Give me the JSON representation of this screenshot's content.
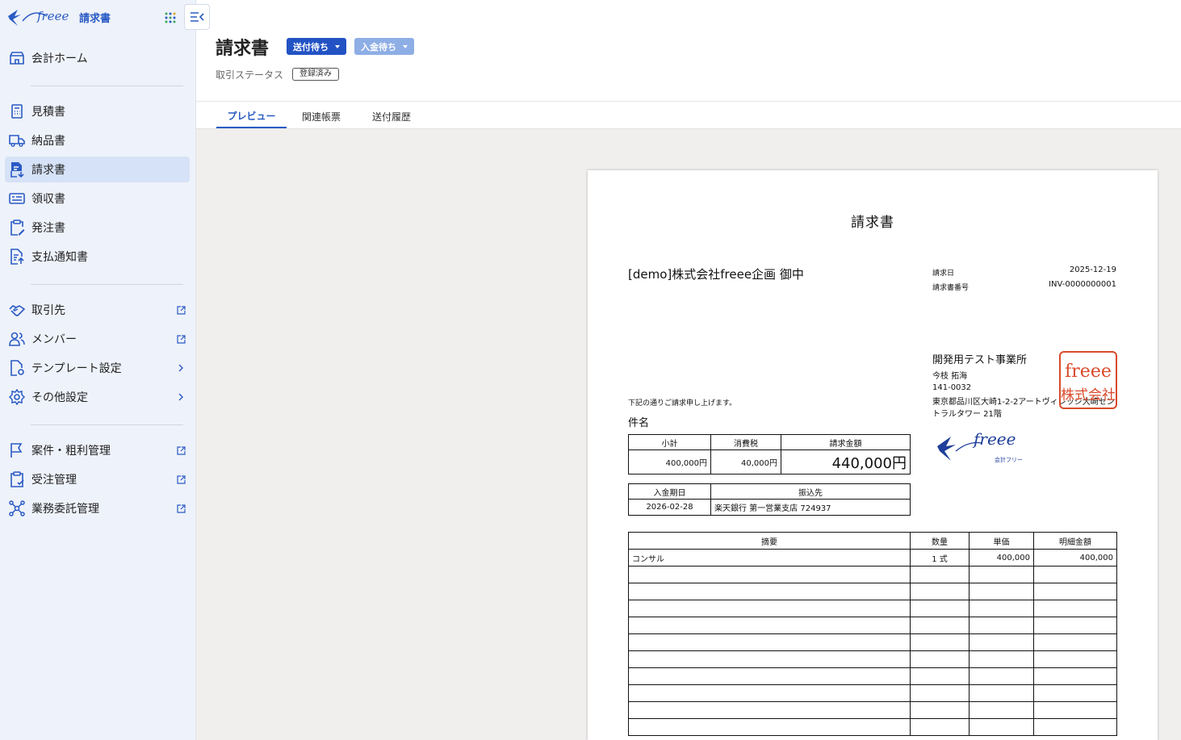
{
  "brand": {
    "product": "請求書"
  },
  "sidebar": {
    "items": [
      {
        "label": "会計ホーム"
      },
      {
        "label": "見積書"
      },
      {
        "label": "納品書"
      },
      {
        "label": "請求書"
      },
      {
        "label": "領収書"
      },
      {
        "label": "発注書"
      },
      {
        "label": "支払通知書"
      },
      {
        "label": "取引先"
      },
      {
        "label": "メンバー"
      },
      {
        "label": "テンプレート設定"
      },
      {
        "label": "その他設定"
      },
      {
        "label": "案件・粗利管理"
      },
      {
        "label": "受注管理"
      },
      {
        "label": "業務委託管理"
      }
    ]
  },
  "header": {
    "title": "請求書",
    "send_status": "送付待ち",
    "payment_status": "入金待ち",
    "deal_status_label": "取引ステータス",
    "deal_status_badge": "登録済み"
  },
  "tabs": [
    "プレビュー",
    "関連帳票",
    "送付履歴"
  ],
  "invoice": {
    "title": "請求書",
    "customer": "[demo]株式会社freee企画 御中",
    "date_label": "請求日",
    "date_value": "2025-12-19",
    "number_label": "請求書番号",
    "number_value": "INV-0000000001",
    "sender_name": "開発用テスト事業所",
    "sender_person": "今枝 拓海",
    "sender_zip": "141-0032",
    "sender_address1": "東京都品川区大崎1-2-2アートヴィレッジ大崎セン",
    "sender_address2": "トラルタワー 21階",
    "stamp_text_top": "freee",
    "stamp_text_bottom": "株式会社",
    "logo_sub": "会計フリー",
    "intro": "下記の通りご請求申し上げます。",
    "subject_label": "件名",
    "summary_headers": [
      "小計",
      "消費税",
      "請求金額"
    ],
    "subtotal": "400,000円",
    "tax": "40,000円",
    "total": "440,000円",
    "payment_headers": [
      "入金期日",
      "振込先"
    ],
    "due_date": "2026-02-28",
    "bank": "楽天銀行 第一営業支店 724937",
    "item_headers": [
      "摘要",
      "数量",
      "単価",
      "明細金額"
    ],
    "items": [
      {
        "desc": "コンサル",
        "qty": "1 式",
        "unit": "400,000",
        "amount": "400,000"
      }
    ]
  },
  "colors": {
    "accent": "#2a5bc4",
    "send_button": "#2252c4",
    "payment_button": "#8eaee6",
    "stamp": "#d94a2b"
  }
}
